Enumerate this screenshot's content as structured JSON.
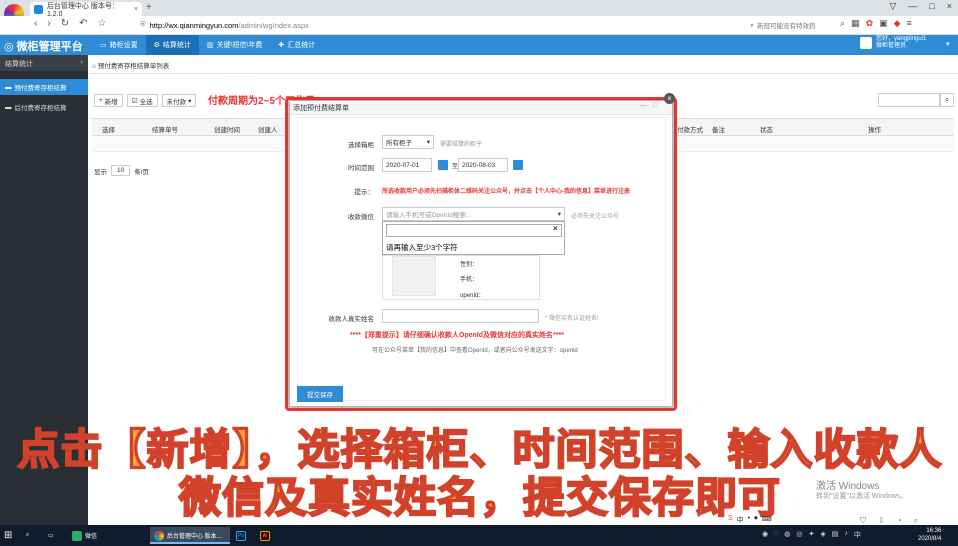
{
  "browser": {
    "tab_title": "后台管理中心 版本号：1.2.0",
    "tab_close": "×",
    "new_tab": "+",
    "window_controls": [
      "▽",
      "—",
      "□",
      "×"
    ],
    "url_domain": "http://wx.qianmingyun.com",
    "url_path": "/admin/wgIndex.aspx",
    "search_placeholder": "新冠可能没有特效药",
    "nav_icons": [
      "back-icon",
      "forward-icon",
      "reload-icon",
      "undo-icon",
      "star-icon"
    ]
  },
  "app": {
    "title": "微柜管理平台",
    "menu": [
      {
        "label": "箱柜设置",
        "active": false
      },
      {
        "label": "结算统计",
        "active": true
      },
      {
        "label": "关键\\短信\\年费",
        "active": false
      },
      {
        "label": "汇总统计",
        "active": false
      }
    ],
    "user_line1": "您好，yangpingui1",
    "user_line2": "微柜管理员"
  },
  "sidebar": {
    "title": "结算统计",
    "items": [
      {
        "label": "预付费寄存柜结算",
        "active": true
      },
      {
        "label": "后付费寄存柜结算",
        "active": false
      }
    ]
  },
  "content": {
    "breadcrumb": "预付费寄存柜结算单列表",
    "toolbar": {
      "add_label": "新增",
      "select_all_label": "全选",
      "filter_value": "未付款",
      "annotation": "付款周期为2~5个工作日"
    },
    "columns": [
      "选择",
      "结算单号",
      "创建时间",
      "创建人",
      "付款方式",
      "备注",
      "状态",
      "操作"
    ],
    "pager": {
      "prefix": "显示",
      "size": "10",
      "suffix": "条/页"
    }
  },
  "modal": {
    "title": "添加预付费结算单",
    "cabinet_label": "选择箱柜",
    "cabinet_value": "所有柜子",
    "cabinet_hint": "需要结算的柜子",
    "range_label": "时间范围",
    "date_from": "2020-07-01",
    "date_sep": "至",
    "date_to": "2020-08-03",
    "notice_label": "提示：",
    "notice_text": "所选收款用户必须先扫描柜体二维码关注公众号，并点击【个人中心-我的信息】菜单进行注册",
    "wechat_label": "收款微信",
    "wechat_placeholder": "请输入手机号或OpenId搜索...",
    "wechat_hint": "必须先关注公众号",
    "dropdown_close": "×",
    "dropdown_msg": "请再输入至少3个字符",
    "info_nickname": "性别：",
    "info_phone": "手机：",
    "info_openid": "openId：",
    "realname_label": "收款人真实姓名",
    "realname_hint": "* 微信实名认证姓名!",
    "warning": "****【郑重提示】请仔细确认收款人OpenId及微信对应的真实姓名****",
    "subnote": "可在公众号菜单【我的信息】中查看OpenId，或者向公众号发送文字：openid",
    "submit_label": "提交保存"
  },
  "caption": {
    "line1": "点击【新增】，选择箱柜、时间范围、输入收款人",
    "line2": "微信及真实姓名，提交保存即可"
  },
  "watermark": {
    "line1": "激活 Windows",
    "line2": "转到\"设置\"以激活 Windows。"
  },
  "taskbar": {
    "wechat_label": "微信",
    "chrome_label": "后台管理中心 版本...",
    "time": "16:36",
    "date": "2020/8/4",
    "ime": "中"
  }
}
